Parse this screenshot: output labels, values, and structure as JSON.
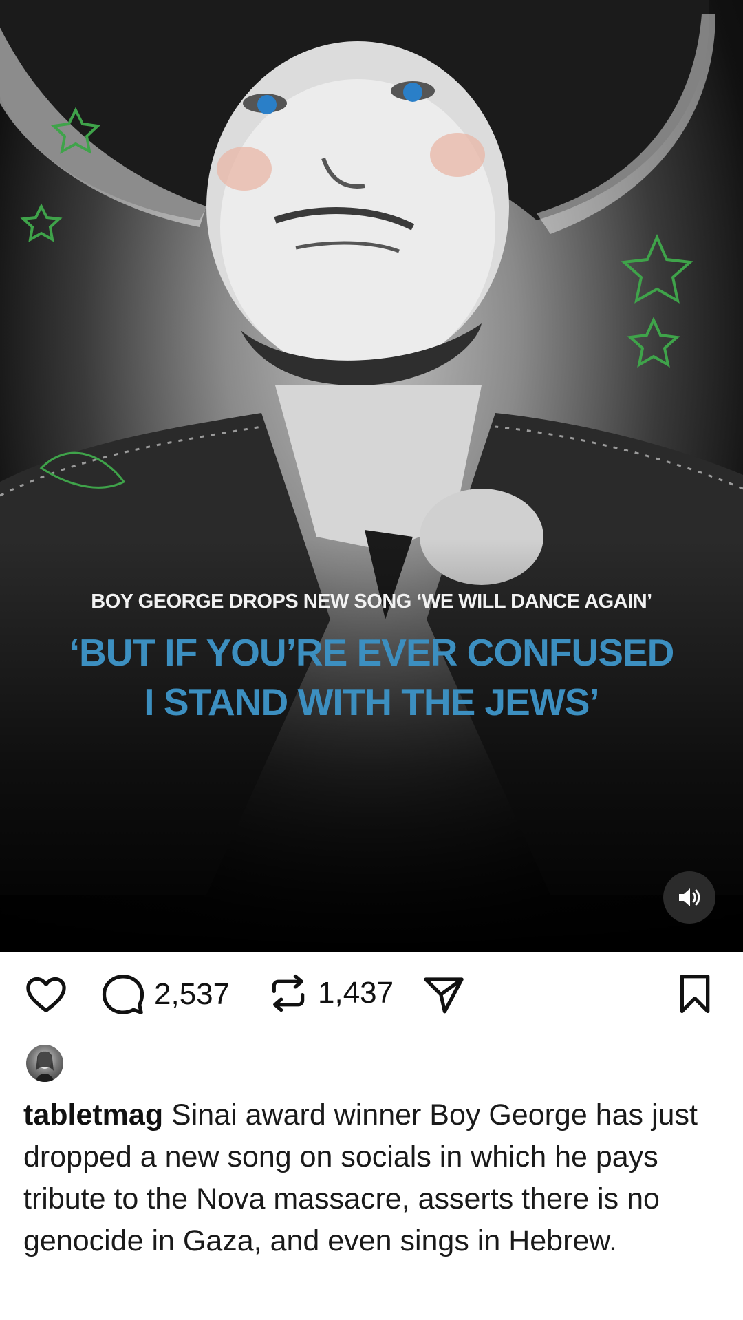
{
  "post": {
    "media": {
      "headline": "BOY GEORGE DROPS NEW SONG ‘WE WILL DANCE AGAIN’",
      "quote_line1": "‘BUT IF YOU’RE EVER CONFUSED",
      "quote_line2": "I STAND WITH THE JEWS’",
      "quote_color": "#3c8fc0",
      "sound_icon": "speaker-on-icon"
    },
    "actions": {
      "like_icon": "heart-icon",
      "comment_icon": "comment-bubble-icon",
      "comment_count": "2,537",
      "repost_icon": "repost-icon",
      "repost_count": "1,437",
      "share_icon": "send-icon",
      "save_icon": "bookmark-icon"
    },
    "author": {
      "username": "tabletmag"
    },
    "caption": {
      "text": " Sinai award winner Boy George has just dropped a new song on socials in which he pays tribute to the Nova massacre, asserts there is no genocide in Gaza, and even sings in Hebrew."
    }
  }
}
